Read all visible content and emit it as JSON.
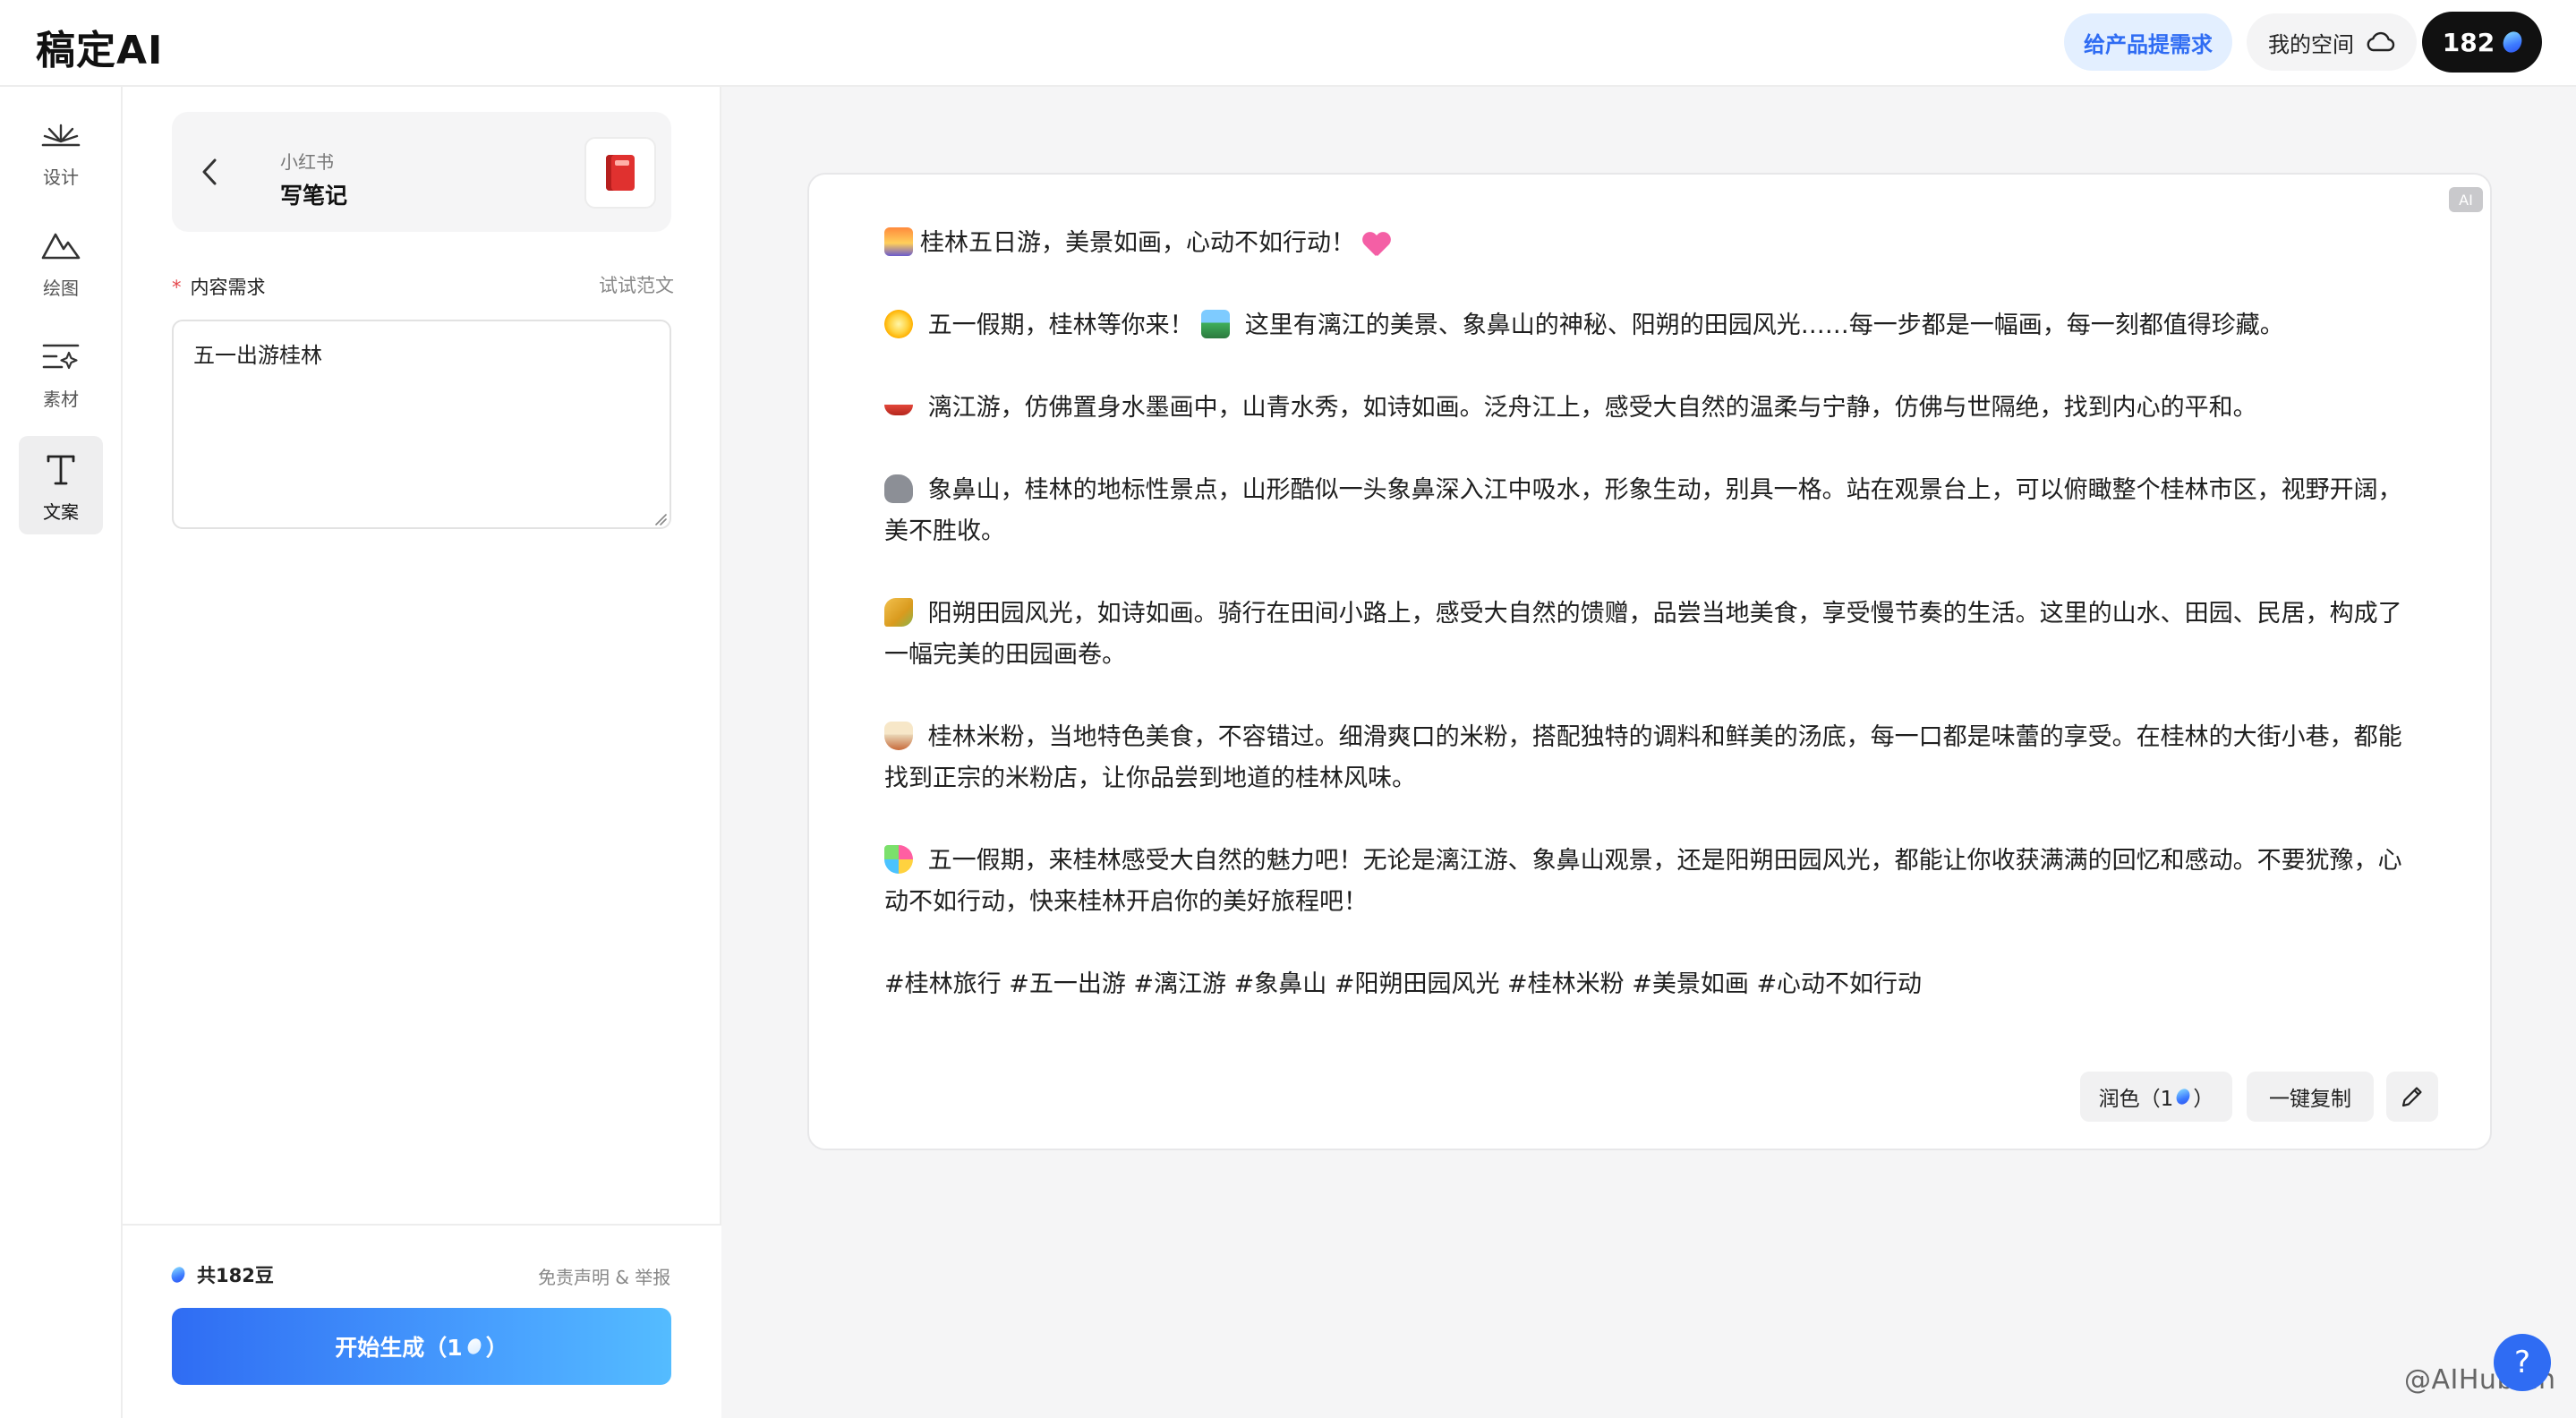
{
  "header": {
    "logo": "稿定AI",
    "request_button": "给产品提需求",
    "my_space_button": "我的空间",
    "beans_count": "182"
  },
  "nav": {
    "items": [
      {
        "label": "设计",
        "icon": "design-icon"
      },
      {
        "label": "绘图",
        "icon": "draw-mountain-icon"
      },
      {
        "label": "素材",
        "icon": "material-icon"
      },
      {
        "label": "文案",
        "icon": "text-icon",
        "active": true
      }
    ]
  },
  "panel": {
    "breadcrumb_parent": "小红书",
    "breadcrumb_title": "写笔记",
    "badge_icon": "red-book-icon",
    "field_label": "内容需求",
    "field_example_link": "试试范文",
    "field_value": "五一出游桂林",
    "total_beans": "共182豆",
    "disclaimer": "免责声明 & 举报",
    "generate_label": "开始生成（1",
    "generate_suffix": "）"
  },
  "result": {
    "ai_tag": "AI",
    "title": "桂林五日游，美景如画，心动不如行动！",
    "paragraphs": [
      "五一假期，桂林等你来！",
      "这里有漓江的美景、象鼻山的神秘、阳朔的田园风光……每一步都是一幅画，每一刻都值得珍藏。",
      "漓江游，仿佛置身水墨画中，山青水秀，如诗如画。泛舟江上，感受大自然的温柔与宁静，仿佛与世隔绝，找到内心的平和。",
      "象鼻山，桂林的地标性景点，山形酷似一头象鼻深入江中吸水，形象生动，别具一格。站在观景台上，可以俯瞰整个桂林市区，视野开阔，美不胜收。",
      "阳朔田园风光，如诗如画。骑行在田间小路上，感受大自然的馈赠，品尝当地美食，享受慢节奏的生活。这里的山水、田园、民居，构成了一幅完美的田园画卷。",
      "桂林米粉，当地特色美食，不容错过。细滑爽口的米粉，搭配独特的调料和鲜美的汤底，每一口都是味蕾的享受。在桂林的大街小巷，都能找到正宗的米粉店，让你品尝到地道的桂林风味。",
      "五一假期，来桂林感受大自然的魅力吧！无论是漓江游、象鼻山观景，还是阳朔田园风光，都能让你收获满满的回忆和感动。不要犹豫，心动不如行动，快来桂林开启你的美好旅程吧！"
    ],
    "tags": "#桂林旅行 #五一出游 #漓江游 #象鼻山 #阳朔田园风光 #桂林米粉 #美景如画 #心动不如行动",
    "polish_label": "润色（1",
    "polish_suffix": "）",
    "copy_label": "一键复制"
  },
  "footer": {
    "help": "?",
    "watermark": "@AIHub.cn"
  },
  "colors": {
    "accent": "#2f6cf3",
    "request_bg": "#e3efff",
    "main_bg": "#f5f5f6"
  }
}
